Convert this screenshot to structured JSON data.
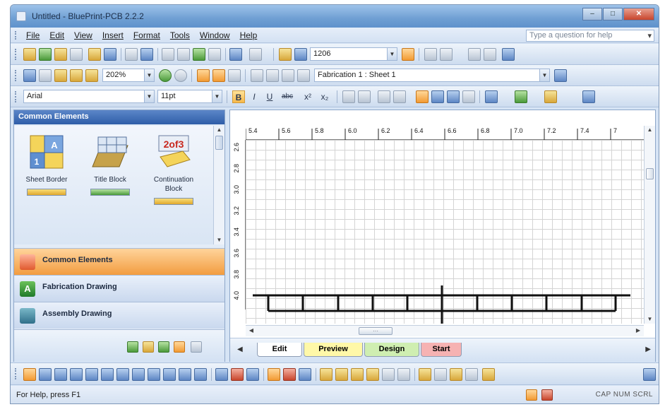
{
  "window": {
    "title": "Untitled - BluePrint-PCB 2.2.2",
    "controls": {
      "minimize": "–",
      "maximize": "□",
      "close": "✕"
    }
  },
  "menubar": {
    "items": [
      {
        "label": "File"
      },
      {
        "label": "Edit"
      },
      {
        "label": "View"
      },
      {
        "label": "Insert"
      },
      {
        "label": "Format"
      },
      {
        "label": "Tools"
      },
      {
        "label": "Window"
      },
      {
        "label": "Help"
      }
    ],
    "help_placeholder": "Type a question for help"
  },
  "toolbar1": {
    "part_combo_value": "1206"
  },
  "toolbar2": {
    "zoom_value": "202%",
    "sheet_combo_value": "Fabrication 1 : Sheet 1"
  },
  "format_toolbar": {
    "font_value": "Arial",
    "size_value": "11pt",
    "bold": "B",
    "italic": "I",
    "underline": "U",
    "strike": "abc",
    "superscript": "x²",
    "subscript": "x₂"
  },
  "left_panel": {
    "header": "Common Elements",
    "shapes": [
      {
        "label": "Sheet Border"
      },
      {
        "label": "Title Block"
      },
      {
        "label": "Continuation Block"
      }
    ],
    "categories": [
      {
        "label": "Common Elements",
        "icon_letter": ""
      },
      {
        "label": "Fabrication Drawing",
        "icon_letter": "A"
      },
      {
        "label": "Assembly Drawing",
        "icon_letter": ""
      }
    ]
  },
  "canvas": {
    "ruler_top": [
      "5.4",
      "5.6",
      "5.8",
      "6.0",
      "6.2",
      "6.4",
      "6.6",
      "6.8",
      "7.0",
      "7.2",
      "7.4",
      "7"
    ],
    "ruler_left": [
      "2.6",
      "2.8",
      "3.0",
      "3.2",
      "3.4",
      "3.6",
      "3.8",
      "4.0"
    ],
    "tabs": [
      {
        "label": "Edit",
        "color": "#ffffff"
      },
      {
        "label": "Preview",
        "color": "#fff8a8"
      },
      {
        "label": "Design",
        "color": "#cfeeb1"
      },
      {
        "label": "Start",
        "color": "#f6b2b2"
      }
    ]
  },
  "statusbar": {
    "text": "For Help, press F1",
    "indicators": "CAP NUM SCRL"
  },
  "colors": {
    "accent_orange": "#f29c3f",
    "header_blue": "#2f5ea8",
    "window_bg": "#d6e4f5"
  }
}
